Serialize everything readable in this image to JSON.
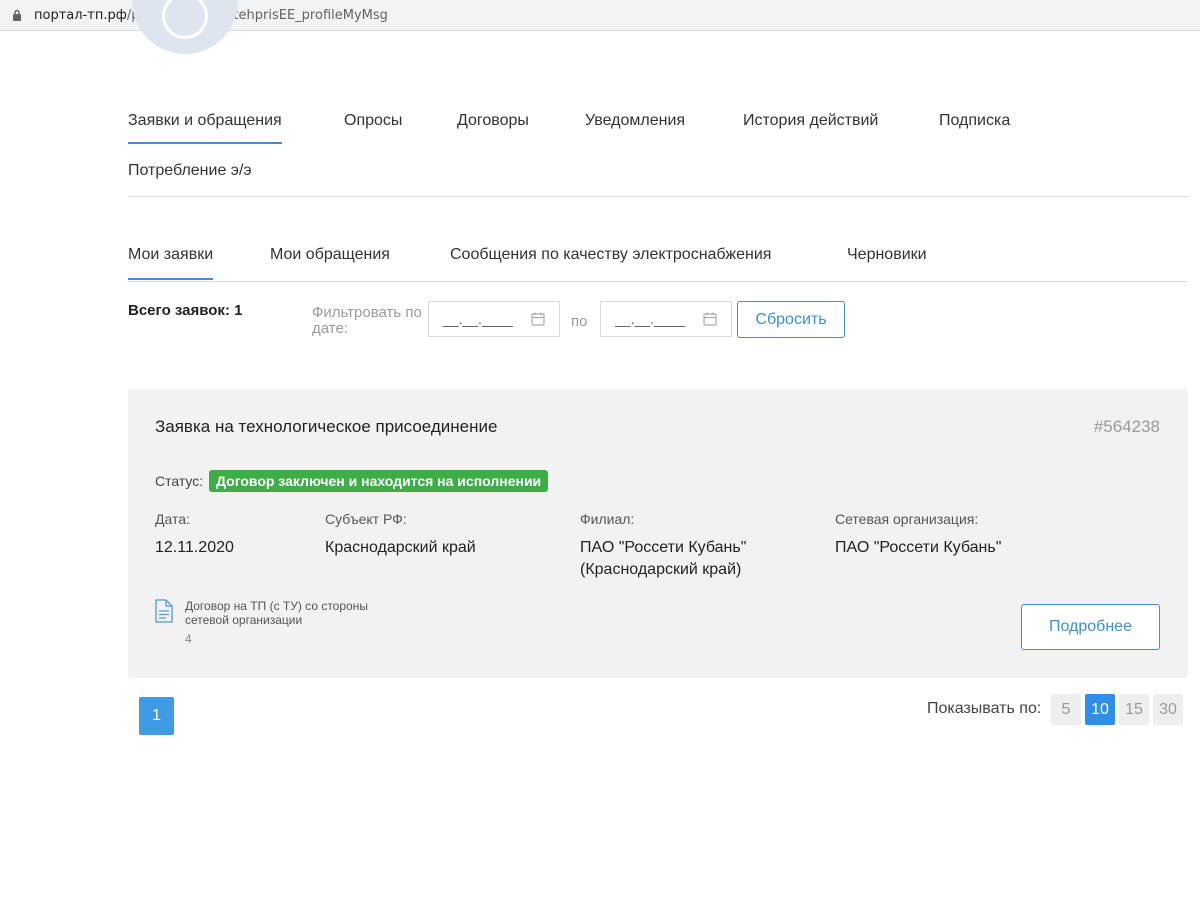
{
  "browser": {
    "url_host": "портал-тп.рф",
    "url_path": "/platform/portal/tehprisEE_profileMyMsg"
  },
  "main_tabs": [
    {
      "label": "Заявки и обращения",
      "active": true
    },
    {
      "label": "Опросы"
    },
    {
      "label": "Договоры"
    },
    {
      "label": "Уведомления"
    },
    {
      "label": "История действий"
    },
    {
      "label": "Подписка"
    },
    {
      "label": "Потребление э/э"
    }
  ],
  "sub_tabs": [
    {
      "label": "Мои заявки",
      "active": true
    },
    {
      "label": "Мои обращения"
    },
    {
      "label": "Сообщения по качеству электроснабжения"
    },
    {
      "label": "Черновики"
    }
  ],
  "filter": {
    "total_label": "Всего заявок: 1",
    "date_label": "Фильтровать по дате:",
    "date_from_mask": "__.__.____",
    "separator": "по",
    "date_to_mask": "__.__.____",
    "reset_label": "Сбросить"
  },
  "request": {
    "title": "Заявка на технологическое присоединение",
    "id": "#564238",
    "status_label": "Статус:",
    "status_value": "Договор заключен и находится на исполнении",
    "status_color": "#3dae46",
    "fields": {
      "date": {
        "label": "Дата:",
        "value": "12.11.2020"
      },
      "subject": {
        "label": "Субъект РФ:",
        "value": "Краснодарский край"
      },
      "branch": {
        "label": "Филиал:",
        "value": "ПАО \"Россети Кубань\" (Краснодарский край)"
      },
      "network_org": {
        "label": "Сетевая организация:",
        "value": "ПАО \"Россети Кубань\""
      }
    },
    "document": {
      "icon": "document-icon",
      "text": "Договор на ТП (с ТУ) со стороны сетевой организации",
      "count": "4"
    },
    "details_label": "Подробнее"
  },
  "pagination": {
    "current_page": "1",
    "show_label": "Показывать по:",
    "sizes": [
      "5",
      "10",
      "15",
      "30"
    ],
    "active_size": "10"
  },
  "colors": {
    "accent": "#3f8fd6",
    "card_bg": "#f2f2f2"
  }
}
